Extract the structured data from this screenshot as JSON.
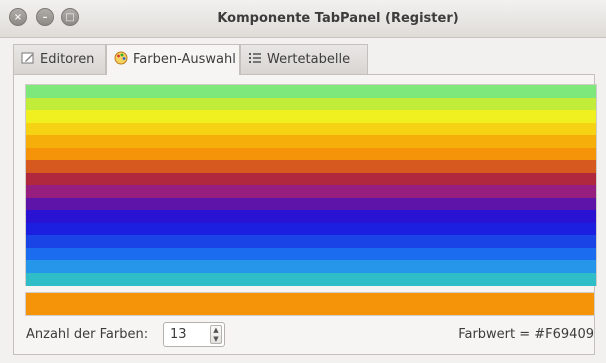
{
  "window": {
    "title": "Komponente TabPanel (Register)",
    "close_glyph": "×",
    "min_glyph": "–",
    "max_glyph": "□"
  },
  "tabs": [
    {
      "label": "Editoren",
      "icon": "edit-icon"
    },
    {
      "label": "Farben-Auswahl",
      "icon": "palette-icon",
      "active": true
    },
    {
      "label": "Wertetabelle",
      "icon": "list-icon"
    }
  ],
  "bands": [
    "#7fe87d",
    "#c2ec3a",
    "#f0f020",
    "#f5d213",
    "#f6ae0a",
    "#f69409",
    "#d6591f",
    "#b0283d",
    "#951e7e",
    "#5e14a8",
    "#2a12d2",
    "#1c1ee0",
    "#1a44e6",
    "#1c6cf0",
    "#2596ea",
    "#2fbdc8"
  ],
  "selected_color": "#f69409",
  "controls": {
    "count_label": "Anzahl der Farben:",
    "count_value": "13",
    "farbwert_text": "Farbwert = #F69409"
  }
}
